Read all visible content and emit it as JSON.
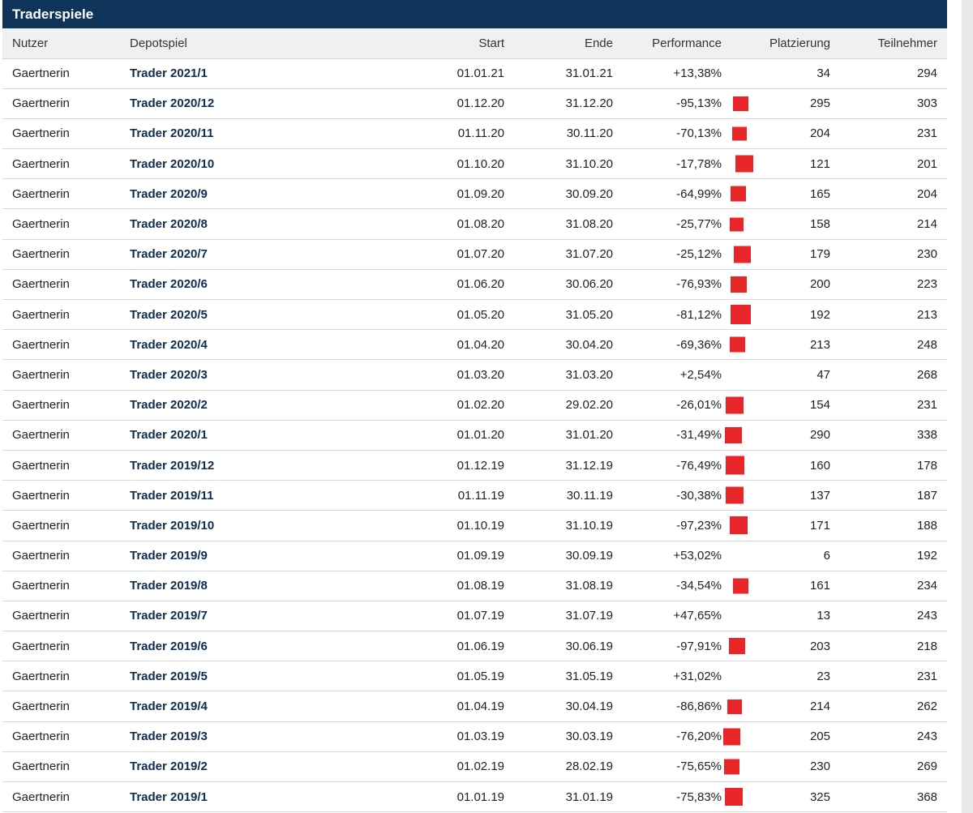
{
  "title": "Traderspiele",
  "columns": [
    "Nutzer",
    "Depotspiel",
    "Start",
    "Ende",
    "Performance",
    "Platzierung",
    "Teilnehmer"
  ],
  "colors": {
    "header": "#0e3459",
    "link": "#0e2d52",
    "marker": "#e8262a"
  },
  "rows": [
    {
      "user": "Gaertnerin",
      "game": "Trader 2021/1",
      "start": "01.01.21",
      "end": "31.01.21",
      "perf": "+13,38%",
      "place": "34",
      "participants": "294",
      "marker": false
    },
    {
      "user": "Gaertnerin",
      "game": "Trader 2020/12",
      "start": "01.12.20",
      "end": "31.12.20",
      "perf": "-95,13%",
      "place": "295",
      "participants": "303",
      "marker": true
    },
    {
      "user": "Gaertnerin",
      "game": "Trader 2020/11",
      "start": "01.11.20",
      "end": "30.11.20",
      "perf": "-70,13%",
      "place": "204",
      "participants": "231",
      "marker": true
    },
    {
      "user": "Gaertnerin",
      "game": "Trader 2020/10",
      "start": "01.10.20",
      "end": "31.10.20",
      "perf": "-17,78%",
      "place": "121",
      "participants": "201",
      "marker": true
    },
    {
      "user": "Gaertnerin",
      "game": "Trader 2020/9",
      "start": "01.09.20",
      "end": "30.09.20",
      "perf": "-64,99%",
      "place": "165",
      "participants": "204",
      "marker": true
    },
    {
      "user": "Gaertnerin",
      "game": "Trader 2020/8",
      "start": "01.08.20",
      "end": "31.08.20",
      "perf": "-25,77%",
      "place": "158",
      "participants": "214",
      "marker": true
    },
    {
      "user": "Gaertnerin",
      "game": "Trader 2020/7",
      "start": "01.07.20",
      "end": "31.07.20",
      "perf": "-25,12%",
      "place": "179",
      "participants": "230",
      "marker": true
    },
    {
      "user": "Gaertnerin",
      "game": "Trader 2020/6",
      "start": "01.06.20",
      "end": "30.06.20",
      "perf": "-76,93%",
      "place": "200",
      "participants": "223",
      "marker": true
    },
    {
      "user": "Gaertnerin",
      "game": "Trader 2020/5",
      "start": "01.05.20",
      "end": "31.05.20",
      "perf": "-81,12%",
      "place": "192",
      "participants": "213",
      "marker": true
    },
    {
      "user": "Gaertnerin",
      "game": "Trader 2020/4",
      "start": "01.04.20",
      "end": "30.04.20",
      "perf": "-69,36%",
      "place": "213",
      "participants": "248",
      "marker": true
    },
    {
      "user": "Gaertnerin",
      "game": "Trader 2020/3",
      "start": "01.03.20",
      "end": "31.03.20",
      "perf": "+2,54%",
      "place": "47",
      "participants": "268",
      "marker": false
    },
    {
      "user": "Gaertnerin",
      "game": "Trader 2020/2",
      "start": "01.02.20",
      "end": "29.02.20",
      "perf": "-26,01%",
      "place": "154",
      "participants": "231",
      "marker": true
    },
    {
      "user": "Gaertnerin",
      "game": "Trader 2020/1",
      "start": "01.01.20",
      "end": "31.01.20",
      "perf": "-31,49%",
      "place": "290",
      "participants": "338",
      "marker": true
    },
    {
      "user": "Gaertnerin",
      "game": "Trader 2019/12",
      "start": "01.12.19",
      "end": "31.12.19",
      "perf": "-76,49%",
      "place": "160",
      "participants": "178",
      "marker": true
    },
    {
      "user": "Gaertnerin",
      "game": "Trader 2019/11",
      "start": "01.11.19",
      "end": "30.11.19",
      "perf": "-30,38%",
      "place": "137",
      "participants": "187",
      "marker": true
    },
    {
      "user": "Gaertnerin",
      "game": "Trader 2019/10",
      "start": "01.10.19",
      "end": "31.10.19",
      "perf": "-97,23%",
      "place": "171",
      "participants": "188",
      "marker": true
    },
    {
      "user": "Gaertnerin",
      "game": "Trader 2019/9",
      "start": "01.09.19",
      "end": "30.09.19",
      "perf": "+53,02%",
      "place": "6",
      "participants": "192",
      "marker": false
    },
    {
      "user": "Gaertnerin",
      "game": "Trader 2019/8",
      "start": "01.08.19",
      "end": "31.08.19",
      "perf": "-34,54%",
      "place": "161",
      "participants": "234",
      "marker": true
    },
    {
      "user": "Gaertnerin",
      "game": "Trader 2019/7",
      "start": "01.07.19",
      "end": "31.07.19",
      "perf": "+47,65%",
      "place": "13",
      "participants": "243",
      "marker": false
    },
    {
      "user": "Gaertnerin",
      "game": "Trader 2019/6",
      "start": "01.06.19",
      "end": "30.06.19",
      "perf": "-97,91%",
      "place": "203",
      "participants": "218",
      "marker": true
    },
    {
      "user": "Gaertnerin",
      "game": "Trader 2019/5",
      "start": "01.05.19",
      "end": "31.05.19",
      "perf": "+31,02%",
      "place": "23",
      "participants": "231",
      "marker": false
    },
    {
      "user": "Gaertnerin",
      "game": "Trader 2019/4",
      "start": "01.04.19",
      "end": "30.04.19",
      "perf": "-86,86%",
      "place": "214",
      "participants": "262",
      "marker": true
    },
    {
      "user": "Gaertnerin",
      "game": "Trader 2019/3",
      "start": "01.03.19",
      "end": "30.03.19",
      "perf": "-76,20%",
      "place": "205",
      "participants": "243",
      "marker": true
    },
    {
      "user": "Gaertnerin",
      "game": "Trader 2019/2",
      "start": "01.02.19",
      "end": "28.02.19",
      "perf": "-75,65%",
      "place": "230",
      "participants": "269",
      "marker": true
    },
    {
      "user": "Gaertnerin",
      "game": "Trader 2019/1",
      "start": "01.01.19",
      "end": "31.01.19",
      "perf": "-75,83%",
      "place": "325",
      "participants": "368",
      "marker": true
    }
  ]
}
